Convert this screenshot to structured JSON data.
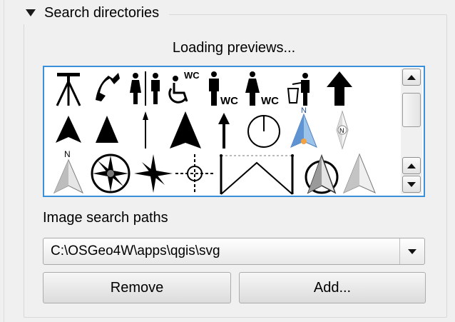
{
  "group": {
    "title": "Search directories",
    "loading_text": "Loading previews..."
  },
  "symbols": [
    "surveyor-tripod-icon",
    "telephone-icon",
    "toilets-icon",
    "wheelchair-wc-icon",
    "men-wc-icon",
    "women-wc-icon",
    "waste-bin-icon",
    "up-arrow-icon",
    "arrowhead-small-icon",
    "arrowhead-icon",
    "thin-arrow-icon",
    "large-arrowhead-icon",
    "line-arrow-icon",
    "circle-tick-icon",
    "blue-north-arrow-icon",
    "compass-needle-icon",
    "north-arrow-icon",
    "compass-rose-icon",
    "four-point-star-icon",
    "crosshair-icon",
    "v-line-icon",
    "north-arrow-circle-icon",
    "arrowhead-grey-icon"
  ],
  "image_search_paths": {
    "label": "Image search paths",
    "selected_path": "C:\\OSGeo4W\\apps\\qgis\\svg"
  },
  "buttons": {
    "remove": "Remove",
    "add": "Add..."
  }
}
